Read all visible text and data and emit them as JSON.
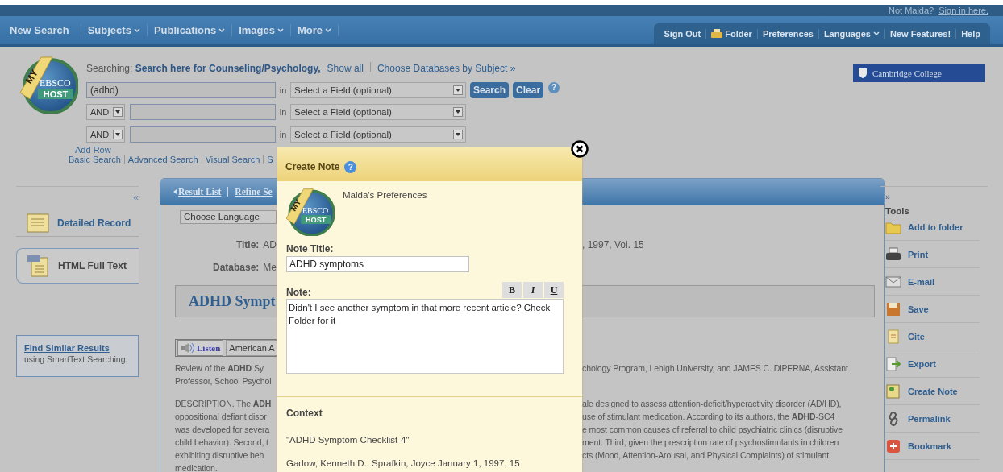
{
  "top_bar": {
    "signin_prompt": "Not Maida?",
    "signin_link": "Sign in here."
  },
  "nav": {
    "items": [
      {
        "label": "New Search",
        "dropdown": false
      },
      {
        "label": "Subjects",
        "dropdown": true
      },
      {
        "label": "Publications",
        "dropdown": true
      },
      {
        "label": "Images",
        "dropdown": true
      },
      {
        "label": "More",
        "dropdown": true
      }
    ],
    "right_items": [
      {
        "label": "Sign Out",
        "kind": "plain"
      },
      {
        "label": "Folder",
        "kind": "folder"
      },
      {
        "label": "Preferences",
        "kind": "plain"
      },
      {
        "label": "Languages",
        "kind": "dropdown"
      },
      {
        "label": "New Features!",
        "kind": "plain"
      },
      {
        "label": "Help",
        "kind": "plain"
      }
    ]
  },
  "logo": {
    "ribbon": "MY",
    "name": "EBSCO",
    "sub": "HOST"
  },
  "search": {
    "searching_label": "Searching:",
    "database": "Search here for Counseling/Psychology,",
    "show_all": "Show all",
    "choose_databases": "Choose Databases by Subject »",
    "rows": [
      {
        "value": "(adhd)",
        "in_label": "in",
        "field": "Select a Field (optional)"
      },
      {
        "operator": "AND",
        "in_label": "in",
        "field": "Select a Field (optional)"
      },
      {
        "operator": "AND",
        "in_label": "in",
        "field": "Select a Field (optional)"
      }
    ],
    "search_button": "Search",
    "clear_button": "Clear",
    "help": "?",
    "add_row": "Add Row",
    "links": [
      "Basic Search",
      "Advanced Search",
      "Visual Search",
      "S"
    ]
  },
  "institution": "Cambridge College",
  "sidebar": {
    "collapse": "«",
    "items": [
      {
        "label": "Detailed Record",
        "kind": "record",
        "selected": false
      },
      {
        "label": "HTML Full Text",
        "kind": "html",
        "selected": true
      }
    ],
    "find_similar": {
      "link": "Find Similar Results",
      "text": "using SmartText Searching."
    }
  },
  "record": {
    "links": [
      "Result List",
      "Refine Se"
    ],
    "language": "Choose Language",
    "fields": [
      {
        "label": "Title:",
        "value": "AD",
        "value_right": ", 1997, Vol. 15"
      },
      {
        "label": "Database:",
        "value": "Me"
      }
    ],
    "heading": "ADHD Sympt",
    "listen": "Listen",
    "voice": "American A",
    "review_left": [
      "Review of the **ADHD** Sy",
      "Professor, School Psychol"
    ],
    "review_right": [
      "chology Program, Lehigh University, and JAMES C. DiPERNA, Assistant"
    ],
    "description_left": [
      "DESCRIPTION. The **ADH**",
      "oppositional defiant disor",
      "was developed for severa",
      "child behavior). Second, t",
      "exhibiting disruptive beh",
      "medication."
    ],
    "description_right": [
      "ale designed to assess attention-deficit/hyperactivity disorder (AD/HD),",
      "use of stimulant medication. According to its authors, the **ADHD**-SC4",
      "e most common causes of referral to child psychiatric clinics (disruptive",
      "ment. Third, given the prescription rate of psychostimulants in children",
      "cts (Mood, Attention-Arousal, and Physical Complaints) of stimulant"
    ]
  },
  "tools": {
    "expand": "»",
    "title": "Tools",
    "items": [
      {
        "label": "Add to folder",
        "kind": "folder"
      },
      {
        "label": "Print",
        "kind": "print"
      },
      {
        "label": "E-mail",
        "kind": "email"
      },
      {
        "label": "Save",
        "kind": "save"
      },
      {
        "label": "Cite",
        "kind": "cite"
      },
      {
        "label": "Export",
        "kind": "export"
      },
      {
        "label": "Create Note",
        "kind": "note"
      },
      {
        "label": "Permalink",
        "kind": "link"
      },
      {
        "label": "Bookmark",
        "kind": "bookmark"
      }
    ]
  },
  "modal": {
    "title": "Create Note",
    "help": "?",
    "logo": {
      "ribbon": "MY",
      "name": "EBSCO",
      "sub": "HOST"
    },
    "owner": "Maida's Preferences",
    "note_title_label": "Note Title:",
    "note_title": "ADHD symptoms",
    "format_buttons": [
      {
        "label": "B",
        "kind": "bold"
      },
      {
        "label": "I",
        "kind": "italic"
      },
      {
        "label": "U",
        "kind": "underline"
      }
    ],
    "note_label": "Note:",
    "note": "Didn't I see another symptom in that more recent article? Check Folder for it",
    "context_label": "Context",
    "context_title": "\"ADHD Symptom Checklist-4\"",
    "citation": "Gadow, Kenneth D., Sprafkin, Joyce January 1, 1997, 15"
  }
}
